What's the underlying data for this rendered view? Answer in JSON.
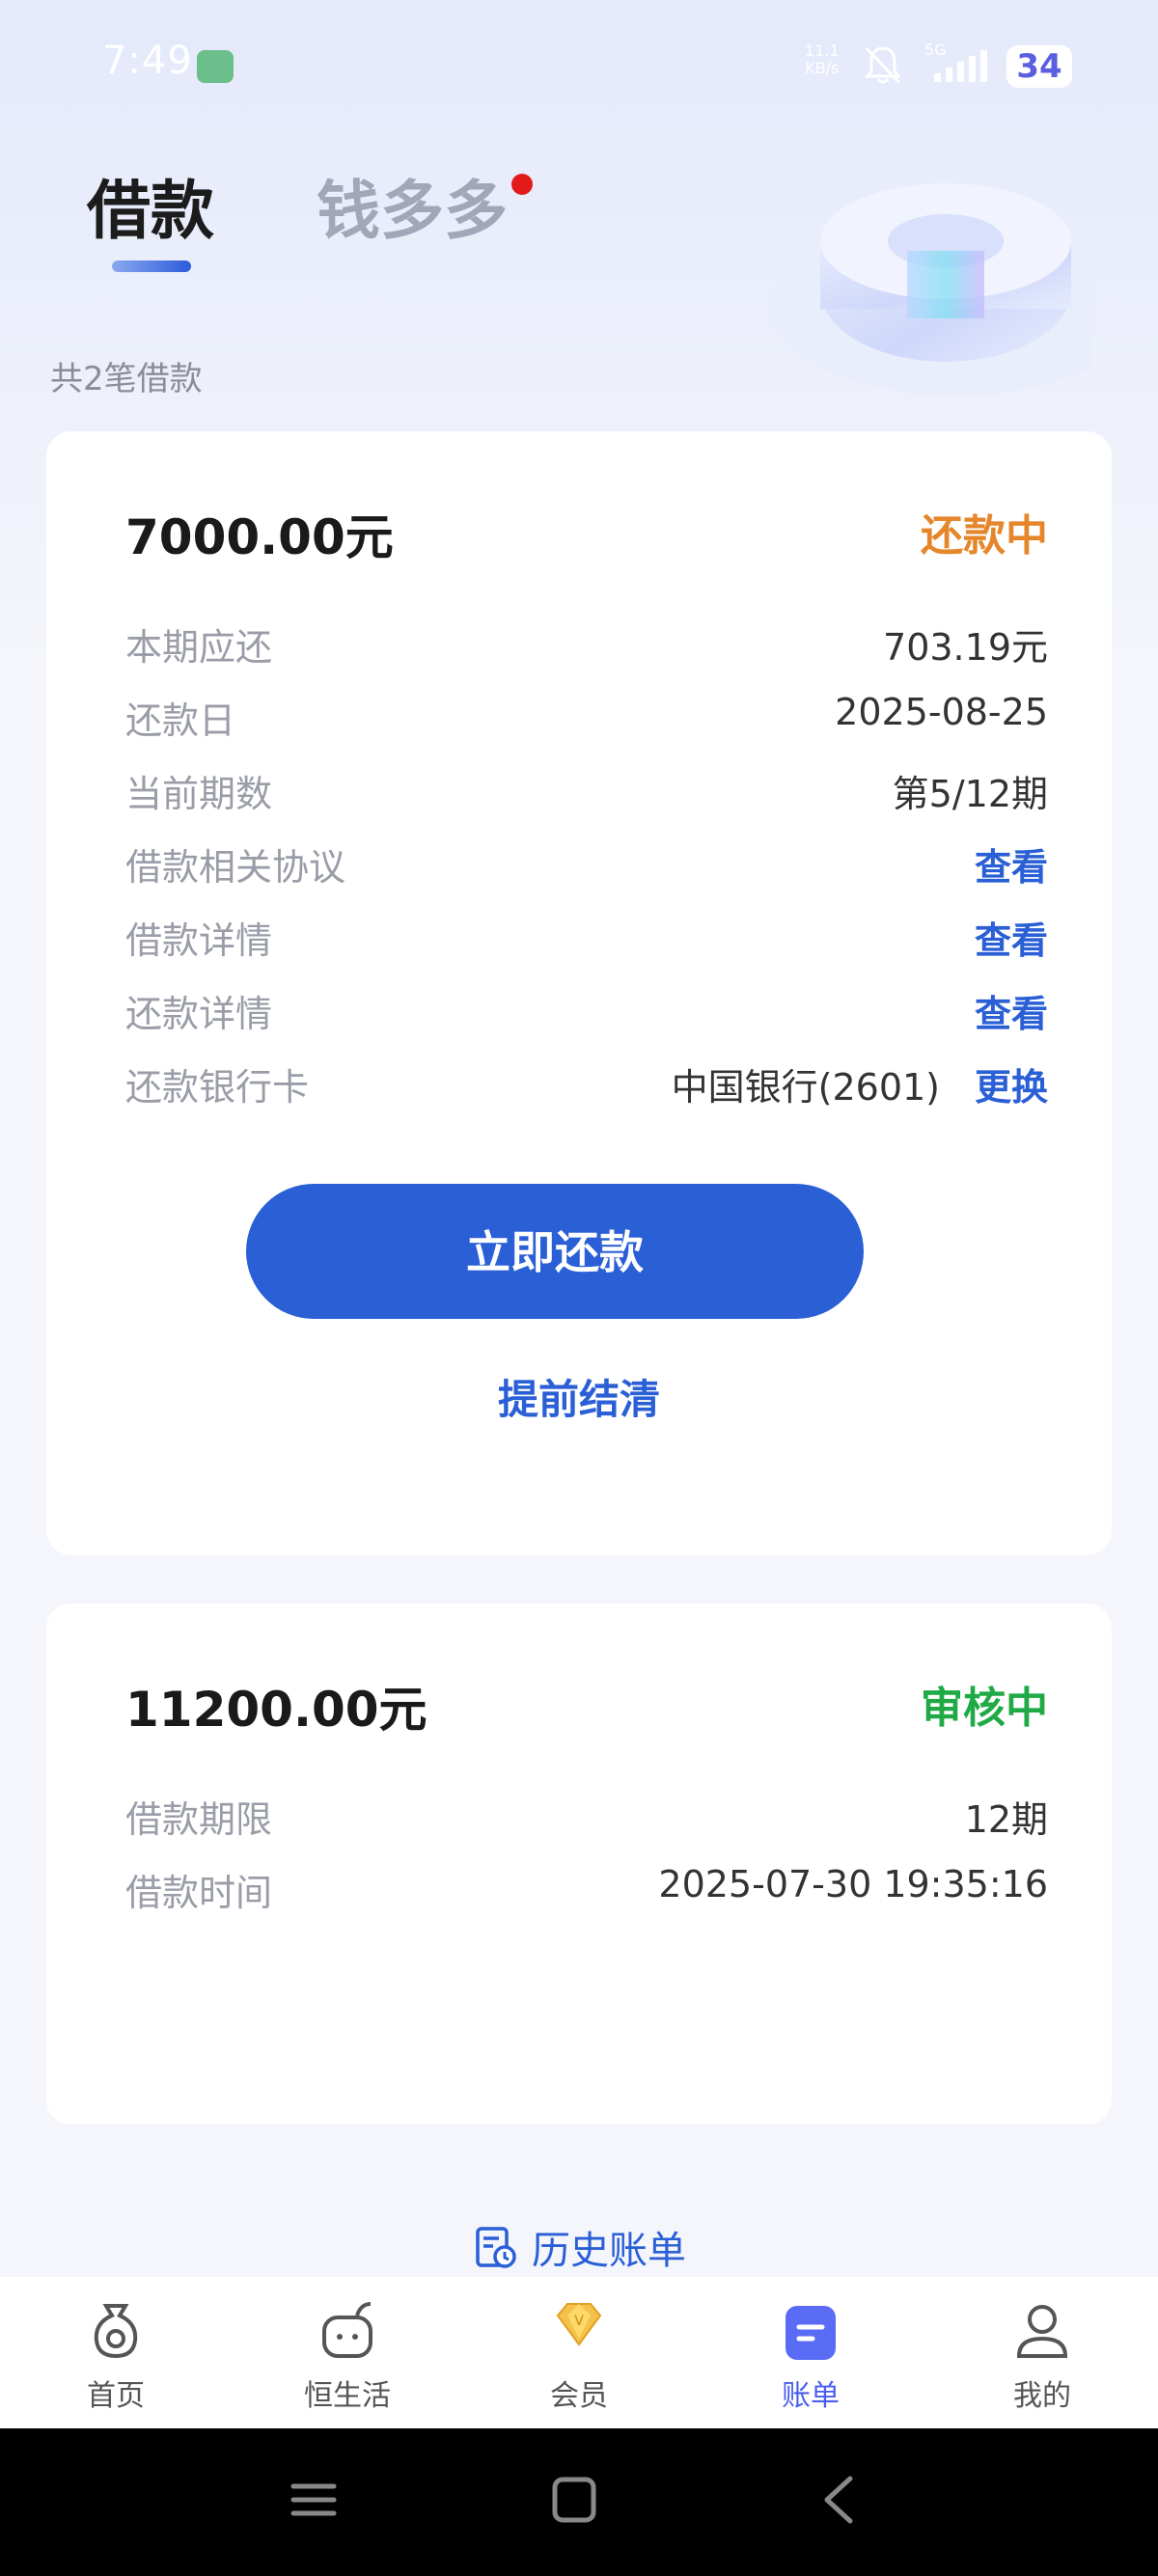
{
  "status_bar": {
    "time": "7:49",
    "net_speed_top": "11.1",
    "net_speed_bottom": "KB/s",
    "signal_label": "5G",
    "battery": "34"
  },
  "tabs": {
    "loan": "借款",
    "qian_duo_duo": "钱多多"
  },
  "summary": {
    "loan_count": "共2笔借款"
  },
  "loan1": {
    "amount": "7000.00元",
    "status": "还款中",
    "rows": [
      {
        "label": "本期应还",
        "value": "703.19元"
      },
      {
        "label": "还款日",
        "value": "2025-08-25"
      },
      {
        "label": "当前期数",
        "value": "第5/12期"
      },
      {
        "label": "借款相关协议",
        "value": "查看"
      },
      {
        "label": "借款详情",
        "value": "查看"
      },
      {
        "label": "还款详情",
        "value": "查看"
      },
      {
        "label": "还款银行卡",
        "bank": "中国银行(2601)",
        "value": "更换"
      }
    ],
    "pay_button": "立即还款",
    "settle_link": "提前结清"
  },
  "loan2": {
    "amount": "11200.00元",
    "status": "审核中",
    "rows": [
      {
        "label": "借款期限",
        "value": "12期"
      },
      {
        "label": "借款时间",
        "value": "2025-07-30 19:35:16"
      }
    ]
  },
  "history": {
    "label": "历史账单"
  },
  "bottom_nav": {
    "items": [
      {
        "label": "首页",
        "icon": "home-icon",
        "active": false
      },
      {
        "label": "恒生活",
        "icon": "life-icon",
        "active": false
      },
      {
        "label": "会员",
        "icon": "vip-diamond-icon",
        "active": false
      },
      {
        "label": "账单",
        "icon": "bill-icon",
        "active": true
      },
      {
        "label": "我的",
        "icon": "profile-icon",
        "active": false
      }
    ]
  },
  "colors": {
    "brand_blue": "#2a5fd6",
    "status_orange": "#e6862b",
    "status_green": "#1faa45",
    "nav_active": "#4a5ef0"
  }
}
